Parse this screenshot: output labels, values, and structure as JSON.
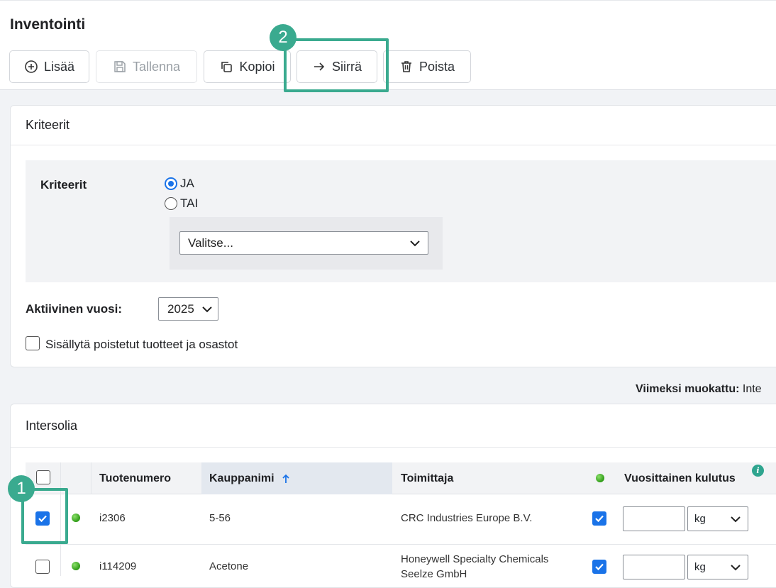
{
  "page": {
    "title": "Inventointi"
  },
  "toolbar": {
    "add_label": "Lisää",
    "save_label": "Tallenna",
    "copy_label": "Kopioi",
    "move_label": "Siirrä",
    "delete_label": "Poista"
  },
  "callouts": {
    "first": "1",
    "second": "2"
  },
  "criteria_card": {
    "title": "Kriteerit",
    "criteria_label": "Kriteerit",
    "radio_and": "JA",
    "radio_or": "TAI",
    "selected_radio": "JA",
    "select_placeholder": "Valitse...",
    "active_year_label": "Aktiivinen vuosi:",
    "active_year_value": "2025",
    "include_deleted_label": "Sisällytä poistetut tuotteet ja osastot"
  },
  "last_modified": {
    "label": "Viimeksi muokattu:",
    "value": "Inte"
  },
  "table_card": {
    "title": "Intersolia",
    "columns": {
      "product_number": "Tuotenumero",
      "trade_name": "Kauppanimi",
      "supplier": "Toimittaja",
      "annual_consumption": "Vuosittainen kulutus"
    },
    "sort_column": "Kauppanimi",
    "sort_direction": "ascending",
    "rows": [
      {
        "selected": true,
        "status": "green",
        "product_number": "i2306",
        "trade_name": "5-56",
        "supplier": "CRC Industries Europe B.V.",
        "supplier_line2": "",
        "flag_checked": true,
        "consumption": "",
        "unit": "kg"
      },
      {
        "selected": false,
        "status": "green",
        "product_number": "i114209",
        "trade_name": "Acetone",
        "supplier": "Honeywell Specialty Chemicals",
        "supplier_line2": "Seelze GmbH",
        "flag_checked": true,
        "consumption": "",
        "unit": "kg"
      }
    ]
  },
  "colors": {
    "accent": "#3aaa8f",
    "primary": "#1a73e8",
    "status_green": "#3cb01c"
  }
}
